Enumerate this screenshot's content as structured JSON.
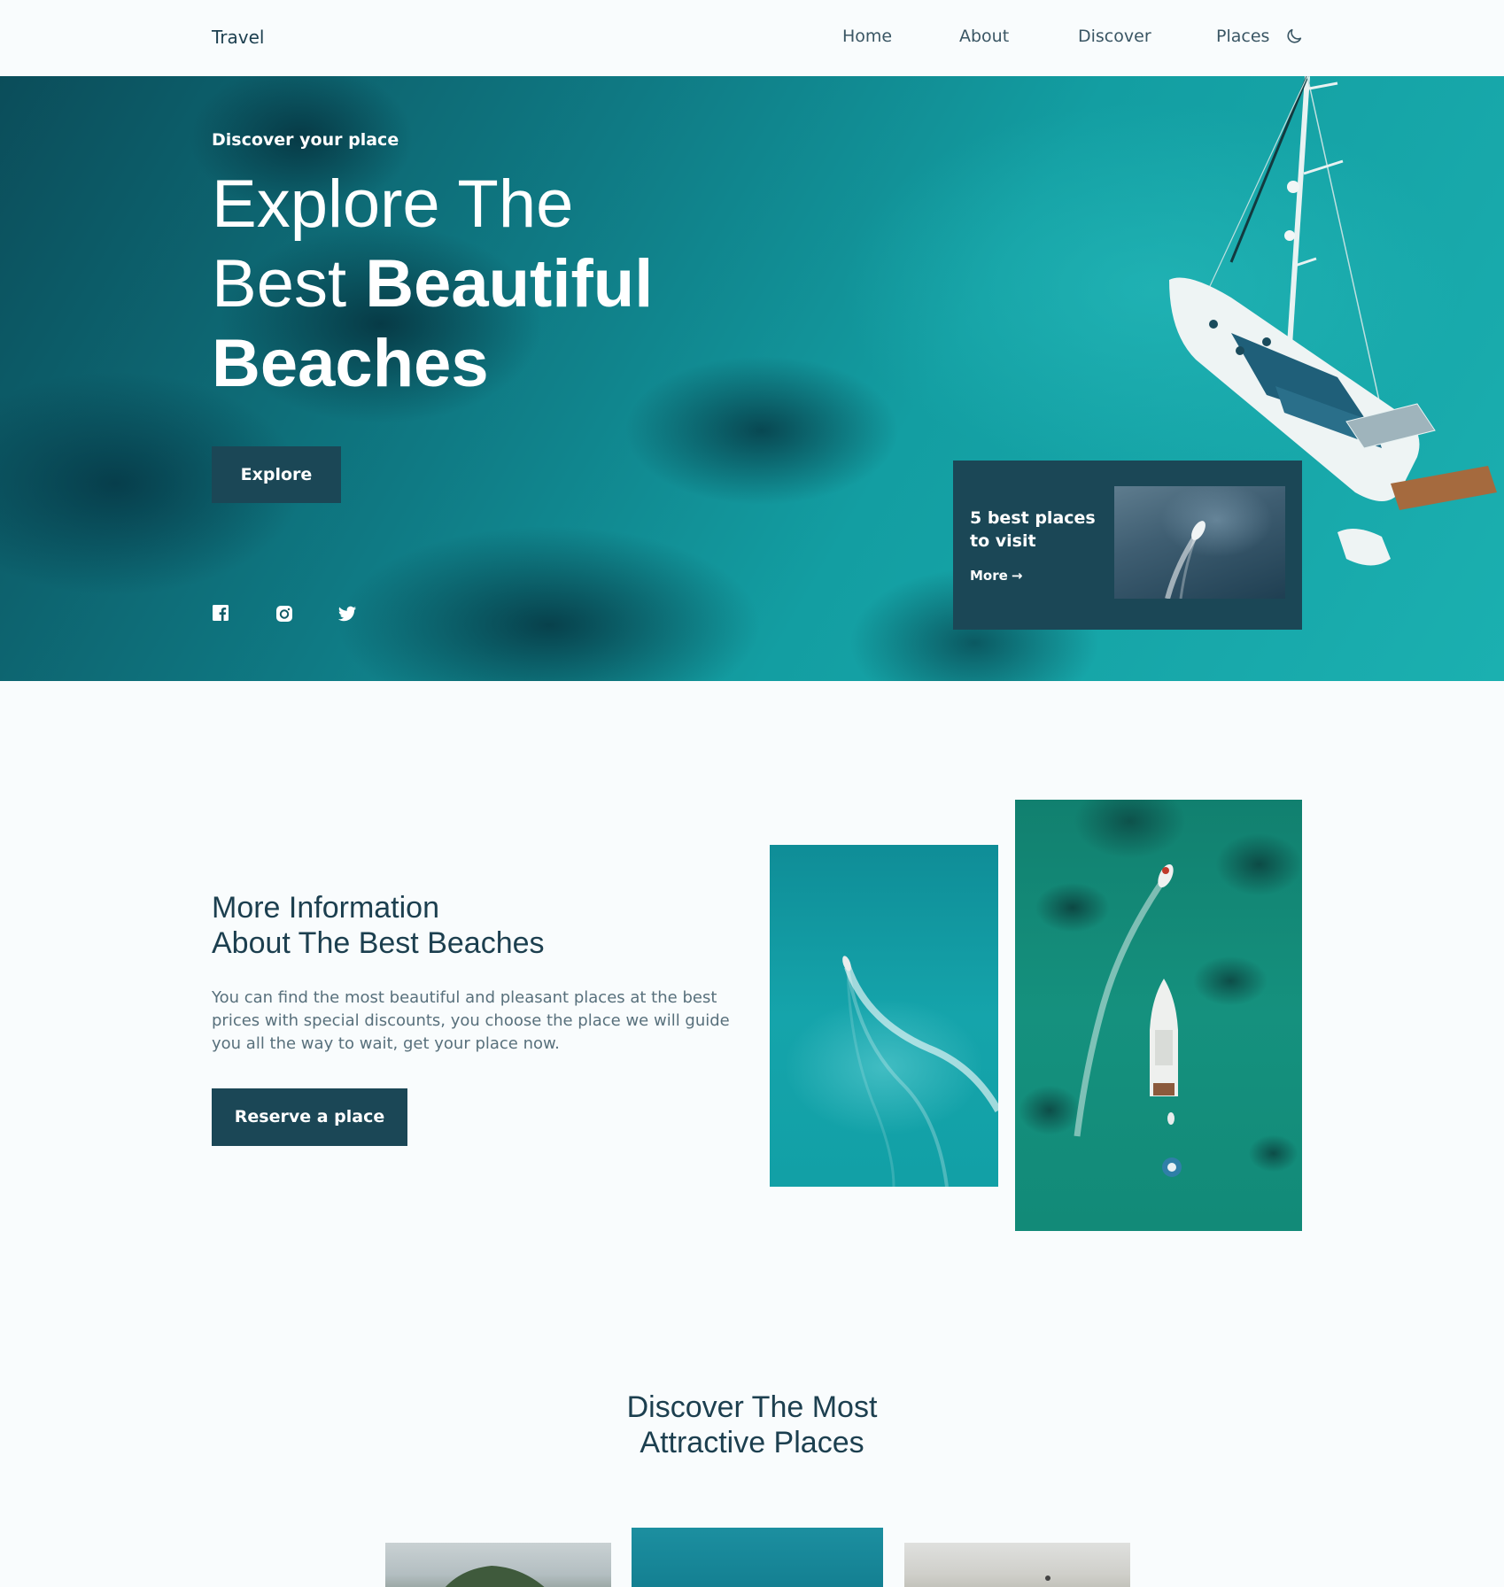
{
  "header": {
    "logo": "Travel",
    "nav": [
      "Home",
      "About",
      "Discover",
      "Places"
    ],
    "theme_icon": "moon-icon"
  },
  "hero": {
    "subtitle": "Discover your place",
    "title_line1": "Explore The",
    "title_line2_light": "Best ",
    "title_line2_bold": "Beautiful",
    "title_line3_bold": "Beaches",
    "button": "Explore",
    "socials": [
      "facebook-icon",
      "instagram-icon",
      "twitter-icon"
    ],
    "promo": {
      "title": "5 best places to visit",
      "more": "More",
      "more_icon": "arrow-right-icon"
    }
  },
  "about": {
    "title_line1": "More Information",
    "title_line2": "About The Best Beaches",
    "text": "You can find the most beautiful and pleasant places at the best prices with special discounts, you choose the place we will guide you all the way to wait, get your place now.",
    "button": "Reserve a place"
  },
  "discover": {
    "title_line1": "Discover The Most",
    "title_line2": "Attractive Places"
  },
  "colors": {
    "accent": "#1b4756",
    "text": "#1c3f4f",
    "background": "#f9fcfd"
  }
}
